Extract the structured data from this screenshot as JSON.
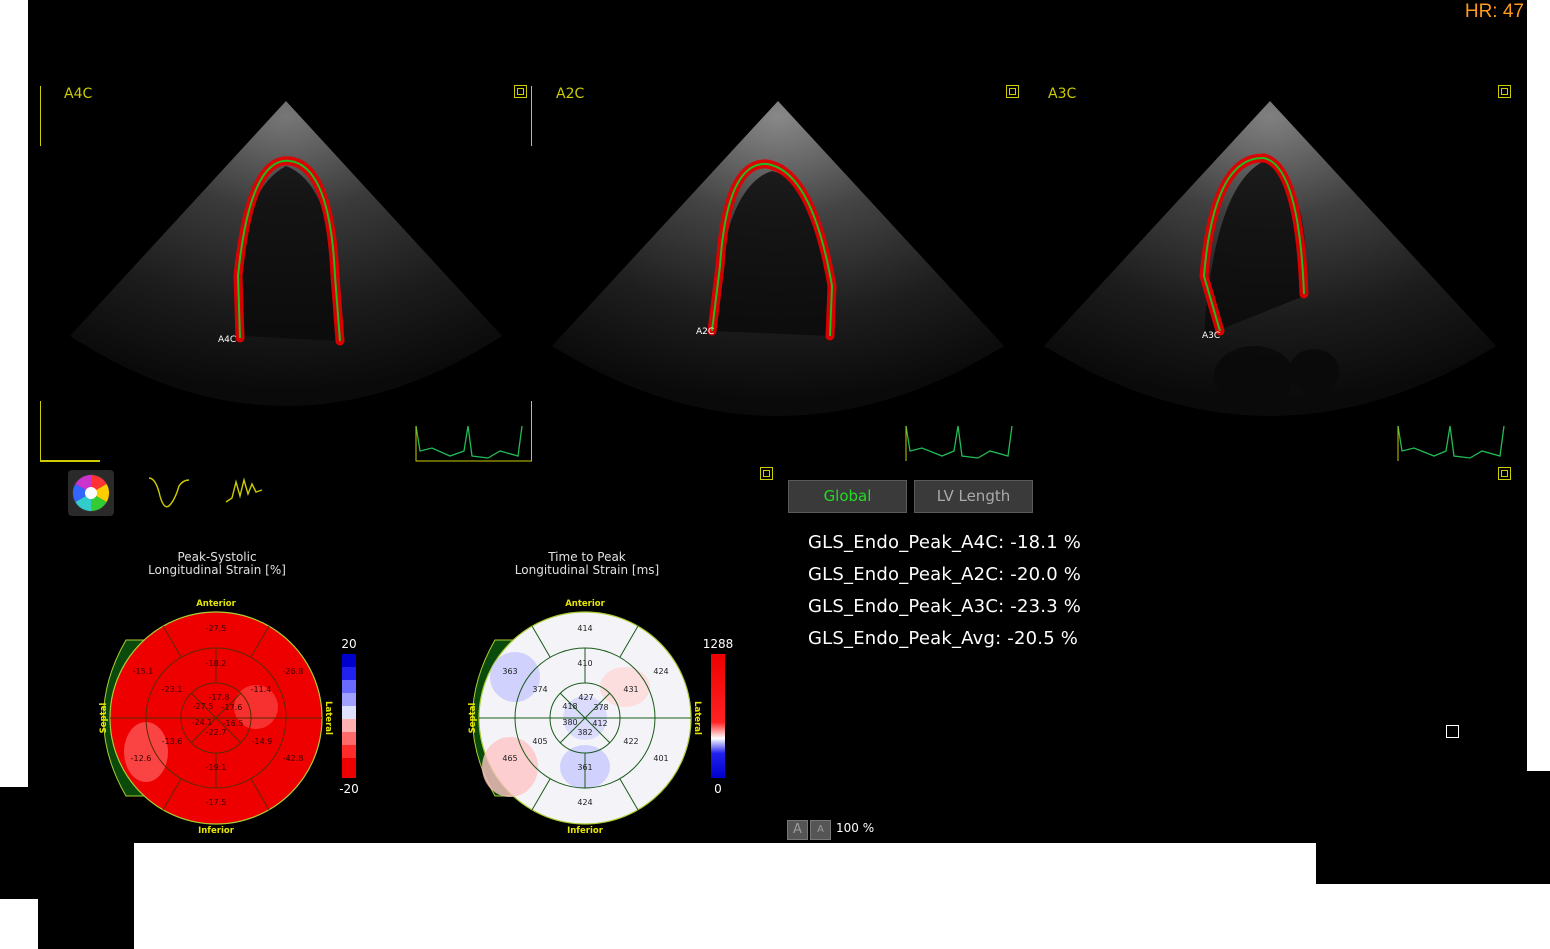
{
  "header": {
    "hr_label": "HR: 47"
  },
  "views": [
    {
      "label": "A4C",
      "marker": "A4C"
    },
    {
      "label": "A2C",
      "marker": "A2C"
    },
    {
      "label": "A3C",
      "marker": "A3C"
    }
  ],
  "tabs": {
    "global": "Global",
    "lv_length": "LV Length"
  },
  "measurements": [
    "GLS_Endo_Peak_A4C: -18.1 %",
    "GLS_Endo_Peak_A2C: -20.0 %",
    "GLS_Endo_Peak_A3C: -23.3 %",
    "GLS_Endo_Peak_Avg: -20.5 %"
  ],
  "bullseye_strain": {
    "title_line1": "Peak-Systolic",
    "title_line2": "Longitudinal Strain [%]",
    "anterior": "Anterior",
    "inferior": "Inferior",
    "septal": "Septal",
    "lateral": "Lateral",
    "scale_max": "20",
    "scale_min": "-20",
    "values": [
      "-27.5",
      "-15.1",
      "-26.8",
      "-18.2",
      "-23.1",
      "-11.4",
      "-17.8",
      "-27.5",
      "-17.6",
      "-24.1",
      "-16.5",
      "-22.7",
      "-13.6",
      "-14.9",
      "-12.6",
      "-42.8",
      "-19.1",
      "-17.5"
    ]
  },
  "bullseye_time": {
    "title_line1": "Time to Peak",
    "title_line2": "Longitudinal Strain [ms]",
    "anterior": "Anterior",
    "inferior": "Inferior",
    "septal": "Septal",
    "lateral": "Lateral",
    "scale_max": "1288",
    "scale_min": "0",
    "values": [
      "414",
      "363",
      "424",
      "410",
      "374",
      "431",
      "427",
      "418",
      "378",
      "380",
      "412",
      "382",
      "405",
      "422",
      "465",
      "401",
      "361",
      "424"
    ]
  },
  "footer": {
    "zoom_btn1": "A",
    "zoom_btn2": "A",
    "zoom_value": "100 %"
  },
  "colors": {
    "accent_yellow": "#cccc00",
    "hr_orange": "#ff9a1a",
    "global_active": "#22dd22",
    "strain_red": "#ee0000"
  }
}
